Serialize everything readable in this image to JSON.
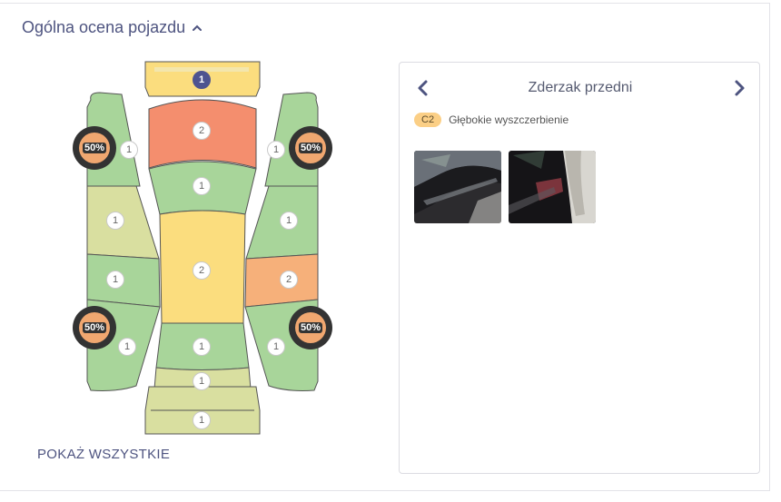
{
  "header": {
    "title": "Ogólna ocena pojazdu"
  },
  "diagram": {
    "colors": {
      "green": "#a8d59a",
      "red": "#f48e6e",
      "yellow": "#fbdd7e",
      "orange": "#f6b07a",
      "olive": "#d9dfa0",
      "blue": "#4e5490"
    },
    "badges": {
      "hood_front": "1",
      "hood": "2",
      "windshield": "1",
      "roof": "2",
      "rear_window": "1",
      "trunk": "1",
      "rear_bumper": "1",
      "left_front_fender": "1",
      "left_front_door": "1",
      "left_rear_door": "1",
      "left_rear_fender": "1",
      "right_front_fender": "1",
      "right_front_door": "1",
      "right_rear_door": "2",
      "right_rear_fender": "1"
    },
    "wheels": {
      "fl": "50%",
      "fr": "50%",
      "rl": "50%",
      "rr": "50%"
    }
  },
  "actions": {
    "show_all": "POKAŻ WSZYSTKIE"
  },
  "detail": {
    "title": "Zderzak przedni",
    "damage_code": "C2",
    "damage_description": "Głębokie wyszczerbienie"
  }
}
